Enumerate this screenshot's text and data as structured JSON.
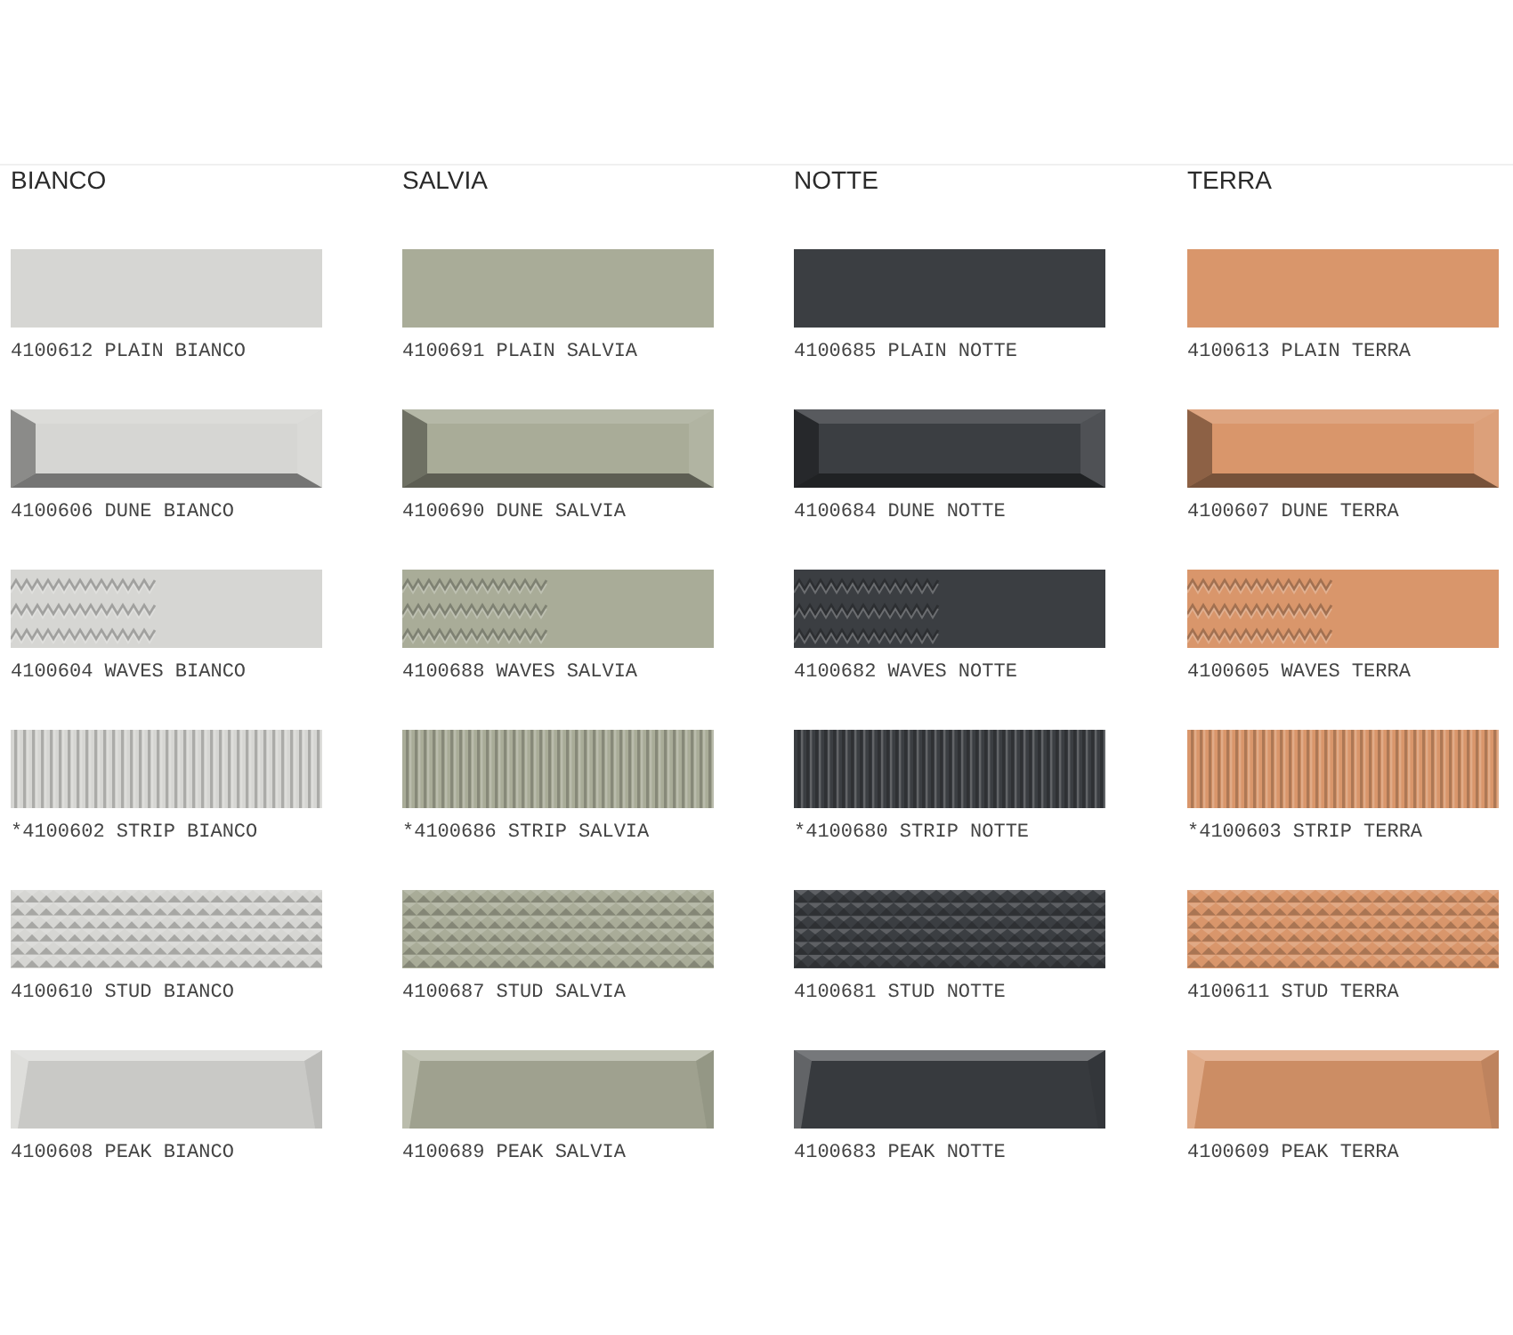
{
  "columns": [
    {
      "name": "BIANCO",
      "color": "#d6d6d3",
      "tiles": [
        {
          "kind": "plain",
          "label": "4100612 PLAIN BIANCO"
        },
        {
          "kind": "dune",
          "label": "4100606 DUNE BIANCO"
        },
        {
          "kind": "waves",
          "label": "4100604 WAVES BIANCO"
        },
        {
          "kind": "strip",
          "label": "*4100602 STRIP BIANCO"
        },
        {
          "kind": "stud",
          "label": "4100610 STUD BIANCO"
        },
        {
          "kind": "peak",
          "label": "4100608 PEAK BIANCO"
        }
      ]
    },
    {
      "name": "SALVIA",
      "color": "#a9ac98",
      "tiles": [
        {
          "kind": "plain",
          "label": "4100691 PLAIN SALVIA"
        },
        {
          "kind": "dune",
          "label": "4100690 DUNE SALVIA"
        },
        {
          "kind": "waves",
          "label": "4100688 WAVES SALVIA"
        },
        {
          "kind": "strip",
          "label": "*4100686 STRIP SALVIA"
        },
        {
          "kind": "stud",
          "label": "4100687 STUD SALVIA"
        },
        {
          "kind": "peak",
          "label": "4100689 PEAK SALVIA"
        }
      ]
    },
    {
      "name": "NOTTE",
      "color": "#3b3e42",
      "tiles": [
        {
          "kind": "plain",
          "label": "4100685 PLAIN NOTTE"
        },
        {
          "kind": "dune",
          "label": "4100684 DUNE NOTTE"
        },
        {
          "kind": "waves",
          "label": "4100682 WAVES NOTTE"
        },
        {
          "kind": "strip",
          "label": "*4100680 STRIP NOTTE"
        },
        {
          "kind": "stud",
          "label": "4100681 STUD NOTTE"
        },
        {
          "kind": "peak",
          "label": "4100683 PEAK NOTTE"
        }
      ]
    },
    {
      "name": "TERRA",
      "color": "#d9966b",
      "tiles": [
        {
          "kind": "plain",
          "label": "4100613 PLAIN TERRA"
        },
        {
          "kind": "dune",
          "label": "4100607 DUNE TERRA"
        },
        {
          "kind": "waves",
          "label": "4100605 WAVES TERRA"
        },
        {
          "kind": "strip",
          "label": "*4100603 STRIP TERRA"
        },
        {
          "kind": "stud",
          "label": "4100611 STUD TERRA"
        },
        {
          "kind": "peak",
          "label": "4100609 PEAK TERRA"
        }
      ]
    }
  ]
}
